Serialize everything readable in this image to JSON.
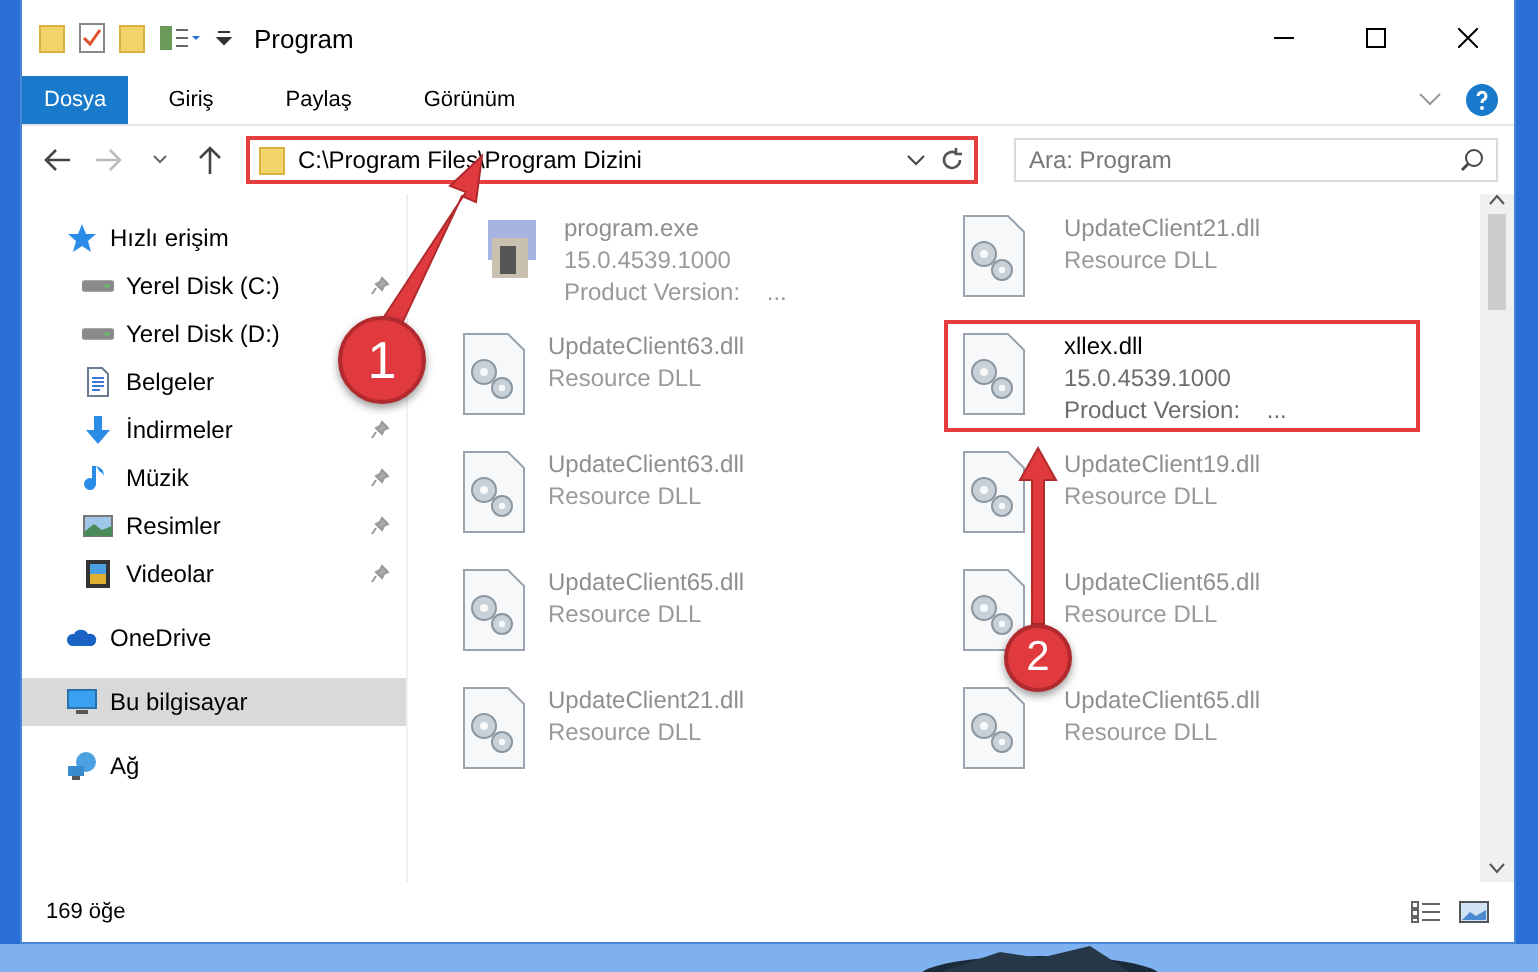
{
  "window": {
    "title": "Program"
  },
  "ribbon": {
    "tabs": [
      {
        "label": "Dosya",
        "selected": true
      },
      {
        "label": "Giriş",
        "selected": false
      },
      {
        "label": "Paylaş",
        "selected": false
      },
      {
        "label": "Görünüm",
        "selected": false
      }
    ]
  },
  "address_bar": {
    "path": "C:\\Program Files\\Program Dizini",
    "highlighted": true
  },
  "search": {
    "placeholder": "Ara: Program"
  },
  "sidebar": {
    "items": [
      {
        "label": "Hızlı erişim",
        "kind": "star",
        "indented": false,
        "pinned": false,
        "selected": false
      },
      {
        "label": "Yerel Disk (C:)",
        "kind": "drive",
        "indented": true,
        "pinned": true,
        "selected": false
      },
      {
        "label": "Yerel Disk (D:)",
        "kind": "drive",
        "indented": true,
        "pinned": false,
        "selected": false
      },
      {
        "label": "Belgeler",
        "kind": "document",
        "indented": true,
        "pinned": false,
        "selected": false
      },
      {
        "label": "İndirmeler",
        "kind": "download",
        "indented": true,
        "pinned": true,
        "selected": false
      },
      {
        "label": "Müzik",
        "kind": "music",
        "indented": true,
        "pinned": true,
        "selected": false
      },
      {
        "label": "Resimler",
        "kind": "pictures",
        "indented": true,
        "pinned": true,
        "selected": false
      },
      {
        "label": "Videolar",
        "kind": "video",
        "indented": true,
        "pinned": true,
        "selected": false
      },
      {
        "label": "OneDrive",
        "kind": "cloud",
        "indented": false,
        "pinned": false,
        "selected": false,
        "gap": true
      },
      {
        "label": "Bu bilgisayar",
        "kind": "computer",
        "indented": false,
        "pinned": false,
        "selected": true,
        "gap": true
      },
      {
        "label": "Ağ",
        "kind": "network",
        "indented": false,
        "pinned": false,
        "selected": false,
        "gap": true
      }
    ]
  },
  "files": [
    {
      "name": "program.exe",
      "kind": "exe",
      "lines": [
        "15.0.4539.1000",
        "Product Version:    ..."
      ],
      "blurred": true,
      "highlighted": false
    },
    {
      "name": "UpdateClient21.dll",
      "kind": "dll",
      "lines": [
        "Resource DLL"
      ],
      "blurred": true,
      "highlighted": false
    },
    {
      "name": "UpdateClient63.dll",
      "kind": "dll",
      "lines": [
        "Resource DLL"
      ],
      "blurred": true,
      "highlighted": false
    },
    {
      "name": "xllex.dll",
      "kind": "dll",
      "lines": [
        "15.0.4539.1000",
        "Product Version:    ..."
      ],
      "blurred": false,
      "highlighted": true
    },
    {
      "name": "UpdateClient63.dll",
      "kind": "dll",
      "lines": [
        "Resource DLL"
      ],
      "blurred": true,
      "highlighted": false
    },
    {
      "name": "UpdateClient19.dll",
      "kind": "dll",
      "lines": [
        "Resource DLL"
      ],
      "blurred": true,
      "highlighted": false
    },
    {
      "name": "UpdateClient65.dll",
      "kind": "dll",
      "lines": [
        "Resource DLL"
      ],
      "blurred": true,
      "highlighted": false
    },
    {
      "name": "UpdateClient65.dll",
      "kind": "dll",
      "lines": [
        "Resource DLL"
      ],
      "blurred": true,
      "highlighted": false
    },
    {
      "name": "UpdateClient21.dll",
      "kind": "dll",
      "lines": [
        "Resource DLL"
      ],
      "blurred": true,
      "highlighted": false
    },
    {
      "name": "UpdateClient65.dll",
      "kind": "dll",
      "lines": [
        "Resource DLL"
      ],
      "blurred": true,
      "highlighted": false
    }
  ],
  "status_bar": {
    "count": "169 öğe"
  },
  "callouts": [
    {
      "number": "1"
    },
    {
      "number": "2"
    }
  ]
}
